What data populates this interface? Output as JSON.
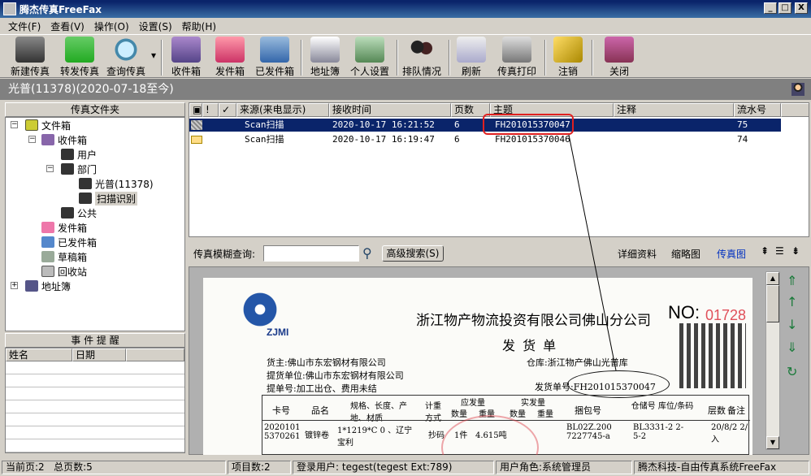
{
  "window": {
    "title": "腾杰传真FreeFax",
    "min": "_",
    "max": "□",
    "close": "X"
  },
  "menu": [
    "文件(F)",
    "查看(V)",
    "操作(O)",
    "设置(S)",
    "帮助(H)"
  ],
  "toolbar": {
    "new_fax": "新建传真",
    "forward_fax": "转发传真",
    "query_fax": "查询传真",
    "inbox": "收件箱",
    "outbox": "发件箱",
    "sent": "已发件箱",
    "address_book": "地址簿",
    "personal_settings": "个人设置",
    "queue": "排队情况",
    "refresh": "刷新",
    "fax_print": "传真打印",
    "logout": "注销",
    "close": "关闭"
  },
  "header": {
    "title": "光普(11378)(2020-07-18至今)"
  },
  "folders": {
    "title": "传真文件夹",
    "filebox": "文件箱",
    "inbox": "收件箱",
    "user": "用户",
    "dept": "部门",
    "guangpu": "光普(11378)",
    "scan": "扫描识别",
    "public": "公共",
    "outbox": "发件箱",
    "sent": "已发件箱",
    "drafts": "草稿箱",
    "recycle": "回收站",
    "address_book": "地址簿"
  },
  "events": {
    "title": "事 件 提 醒",
    "col_name": "姓名",
    "col_date": "日期"
  },
  "list": {
    "headers": {
      "icon": "",
      "flag": "!",
      "check": "✓",
      "source": "来源(来电显示)",
      "time": "接收时间",
      "pages": "页数",
      "subject": "主题",
      "note": "注释",
      "serial": "流水号"
    },
    "rows": [
      {
        "source": "Scan扫描",
        "time": "2020-10-17 16:21:52",
        "pages": "6",
        "subject": "FH201015370047",
        "note": "",
        "serial": "75"
      },
      {
        "source": "Scan扫描",
        "time": "2020-10-17 16:19:47",
        "pages": "6",
        "subject": "FH201015370046",
        "note": "",
        "serial": "74"
      }
    ]
  },
  "search": {
    "label": "传真模糊查询:",
    "placeholder": "",
    "button": "高级搜索(S)"
  },
  "view_tabs": {
    "detail": "详细资料",
    "thumbnail": "缩略图",
    "fax": "传真图"
  },
  "doc": {
    "company": "浙江物产物流投资有限公司佛山分公司",
    "logo": "ZJMI",
    "no_label": "NO:",
    "no_value": "01728",
    "title": "发 货 单",
    "consignee": "货主:佛山市东宏钢材有限公司",
    "warehouse": "仓库:浙江物产佛山光普库",
    "pickup_unit": "提货单位:佛山市东宏钢材有限公司",
    "pickup_no": "提单号:加工出仓、费用未结",
    "ship_no": "发货单号:FH201015370047",
    "cols": [
      "卡号",
      "品名",
      "规格、长度、产地、材质",
      "计重方式",
      "应发量",
      "实发量",
      "捆包号",
      "仓储号 库位/条码",
      "层数",
      "备注"
    ],
    "sub_cols": [
      "数量",
      "重量",
      "数量",
      "重量"
    ],
    "row": {
      "card": "2020101 5370261",
      "name": "镀锌卷",
      "spec": "1*1219*C 0 、辽宁宝利",
      "method": "抄码",
      "qty": "1件",
      "weight": "4.615吨",
      "bundle": "BL02Z.200 7227745-a",
      "storage": "BL3331-2 2-5-2",
      "remark": "20/8/2 2/入"
    }
  },
  "status": {
    "current_page": "当前页:2",
    "total_pages": "总页数:5",
    "items": "项目数:2",
    "login_user": "登录用户: tegest(tegest Ext:789)",
    "role": "用户角色:系统管理员",
    "brand": "腾杰科技-自由传真系统FreeFax"
  }
}
